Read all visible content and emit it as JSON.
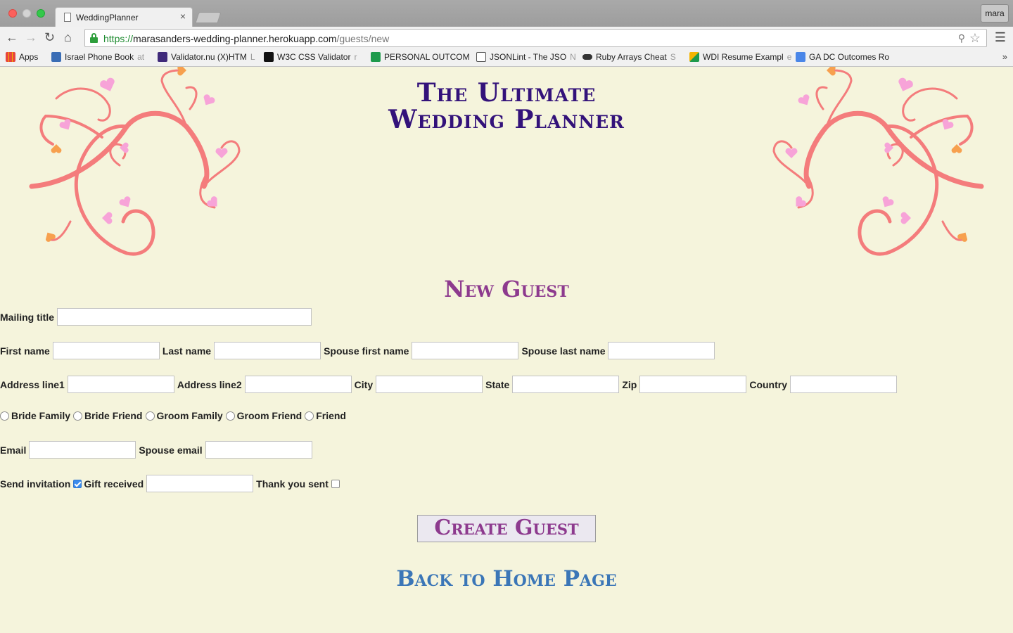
{
  "browser": {
    "tab_title": "WeddingPlanner",
    "tab_close": "×",
    "profile": "mara",
    "url_scheme": "https://",
    "url_host": "marasanders-wedding-planner.herokuapp.com",
    "url_path": "/guests/new",
    "bookmarks": [
      {
        "label": "Apps",
        "fade": ""
      },
      {
        "label": "Israel Phone Book ",
        "fade": "at"
      },
      {
        "label": "Validator.nu (X)HTM",
        "fade": "L"
      },
      {
        "label": "W3C CSS Validator ",
        "fade": "r"
      },
      {
        "label": "PERSONAL OUTCOM",
        "fade": ""
      },
      {
        "label": "JSONLint - The JSO",
        "fade": "N"
      },
      {
        "label": "Ruby Arrays Cheat ",
        "fade": "S"
      },
      {
        "label": "WDI Resume Exampl",
        "fade": "e"
      },
      {
        "label": "GA DC Outcomes Ro",
        "fade": ""
      }
    ],
    "bookmark_icon_colors": [
      "#e8453c",
      "#3a6db5",
      "#3f2a7a",
      "#111111",
      "#1e9a4c",
      "#555555",
      "#333333",
      "#f4b400",
      "#4a86e8"
    ],
    "more": "»"
  },
  "site": {
    "title_line1": "The Ultimate",
    "title_line2": "Wedding Planner"
  },
  "form": {
    "heading": "New Guest",
    "mailing_title": "Mailing title",
    "first_name": "First name",
    "last_name": "Last name",
    "spouse_first_name": "Spouse first name",
    "spouse_last_name": "Spouse last name",
    "address_line1": "Address line1",
    "address_line2": "Address line2",
    "city": "City",
    "state": "State",
    "zip": "Zip",
    "country": "Country",
    "relations": [
      "Bride Family",
      "Bride Friend",
      "Groom Family",
      "Groom Friend",
      "Friend"
    ],
    "email": "Email",
    "spouse_email": "Spouse email",
    "send_invitation": "Send invitation",
    "send_invitation_checked": true,
    "gift_received": "Gift received",
    "thank_you_sent": "Thank you sent",
    "thank_you_sent_checked": false,
    "submit": "Create Guest"
  },
  "nav": {
    "back_home": "Back to Home Page"
  },
  "colors": {
    "background": "#f5f4dc",
    "title": "#33127a",
    "heading": "#8d3a8e",
    "link": "#3b76b7",
    "swirl": "#f47c7c",
    "heart_pink": "#f7a3d8",
    "heart_orange": "#f7a04e"
  }
}
